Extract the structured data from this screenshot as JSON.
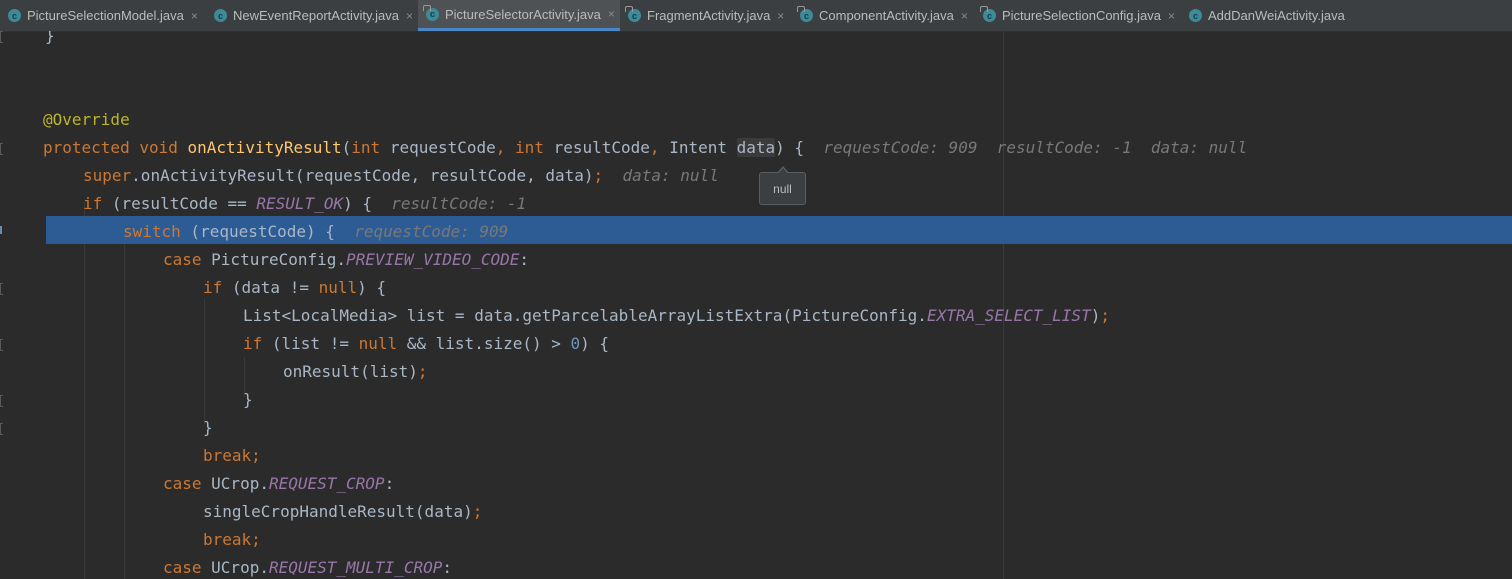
{
  "tabs": [
    {
      "label": "PictureSelectionModel.java",
      "icon": "class-icon",
      "locked": false,
      "active": false
    },
    {
      "label": "NewEventReportActivity.java",
      "icon": "class-icon",
      "locked": false,
      "active": false
    },
    {
      "label": "PictureSelectorActivity.java",
      "icon": "class-icon",
      "locked": true,
      "active": true
    },
    {
      "label": "FragmentActivity.java",
      "icon": "class-icon",
      "locked": true,
      "active": false
    },
    {
      "label": "ComponentActivity.java",
      "icon": "class-icon",
      "locked": true,
      "active": false
    },
    {
      "label": "PictureSelectionConfig.java",
      "icon": "class-icon",
      "locked": true,
      "active": false
    },
    {
      "label": "AddDanWeiActivity.java",
      "icon": "class-icon",
      "locked": false,
      "active": false
    }
  ],
  "icon_glyph": "c",
  "close_glyph": "×",
  "code": {
    "l0": {
      "brace": "}"
    },
    "l3": {
      "annotation": "@Override"
    },
    "l4": {
      "kw_protected": "protected",
      "kw_void": "void",
      "fn": "onActivityResult",
      "open": "(",
      "kw_int1": "int",
      "p1": " requestCode",
      "comma1": ", ",
      "kw_int2": "int",
      "p2": " resultCode",
      "comma2": ", ",
      "type": "Intent ",
      "p3": "data",
      "close": ") {",
      "hint": "requestCode: 909  resultCode: -1  data: null"
    },
    "l5": {
      "kw_super": "super",
      "rest": ".onActivityResult(requestCode, resultCode, data)",
      "semi": ";",
      "hint": "data: null"
    },
    "l6": {
      "kw_if": "if",
      "open": " (resultCode == ",
      "const": "RESULT_OK",
      "close": ") {",
      "hint": "resultCode: -1"
    },
    "l7": {
      "kw_switch": "switch",
      "rest": " (requestCode) {",
      "hint": "requestCode: 909"
    },
    "l8": {
      "kw_case": "case",
      "cls": " PictureConfig.",
      "const": "PREVIEW_VIDEO_CODE",
      "colon": ":"
    },
    "l9": {
      "kw_if": "if",
      "open": " (data != ",
      "kw_null": "null",
      "close": ") {"
    },
    "l10": {
      "pre": "List<LocalMedia> list = data.getParcelableArrayListExtra(PictureConfig.",
      "const": "EXTRA_SELECT_LIST",
      "close": ")",
      "semi": ";"
    },
    "l11": {
      "kw_if": "if",
      "open": " (list != ",
      "kw_null": "null",
      "mid": " && list.size() > ",
      "num": "0",
      "close": ") {"
    },
    "l12": {
      "call": "onResult(list)",
      "semi": ";"
    },
    "l13": {
      "brace": "}"
    },
    "l14": {
      "brace": "}"
    },
    "l15": {
      "kw_break": "break",
      "semi": ";"
    },
    "l16": {
      "kw_case": "case",
      "cls": " UCrop.",
      "const": "REQUEST_CROP",
      "colon": ":"
    },
    "l17": {
      "call": "singleCropHandleResult(data)",
      "semi": ";"
    },
    "l18": {
      "kw_break": "break",
      "semi": ";"
    },
    "l19": {
      "kw_case": "case",
      "cls": " UCrop.",
      "const": "REQUEST_MULTI_CROP",
      "colon": ":"
    }
  },
  "tooltip": {
    "text": "null"
  },
  "colors": {
    "background": "#2b2b2b",
    "keyword": "#cc7832",
    "function": "#ffc66d",
    "constant": "#9876aa",
    "number": "#6897bb",
    "annotation": "#bbb529",
    "text": "#a9b7c6",
    "inline_hint": "#787878",
    "execution_line": "#2d5c94"
  }
}
